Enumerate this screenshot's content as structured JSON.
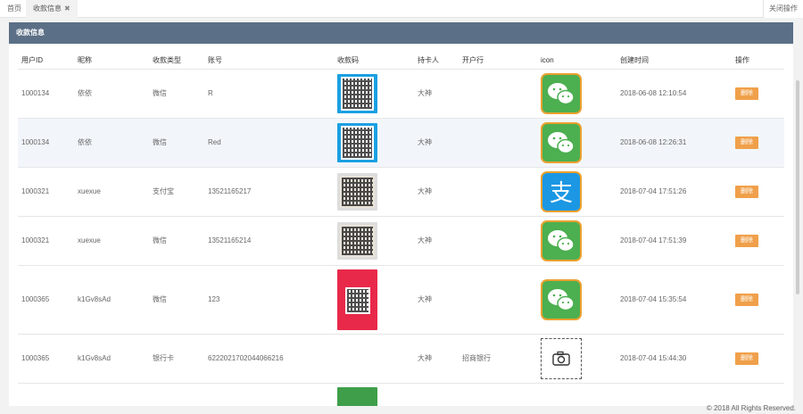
{
  "tabs": {
    "home": "首页",
    "active": "收款信息",
    "close_ops": "关闭操作"
  },
  "panel": {
    "title": "收款信息"
  },
  "columns": [
    "用户ID",
    "昵称",
    "收款类型",
    "账号",
    "收款码",
    "持卡人",
    "开户行",
    "icon",
    "创建时间",
    "操作"
  ],
  "rows": [
    {
      "uid": "1000134",
      "nick": "依依",
      "type": "微信",
      "account": "R",
      "qr": "blue",
      "holder": "大神",
      "bank": "",
      "icon": "wechat-icon",
      "time": "2018-06-08 12:10:54",
      "action": "删除"
    },
    {
      "uid": "1000134",
      "nick": "依依",
      "type": "微信",
      "account": "Red",
      "qr": "blue",
      "holder": "大神",
      "bank": "",
      "icon": "wechat-icon",
      "time": "2018-06-08 12:26:31",
      "action": "删除"
    },
    {
      "uid": "1000321",
      "nick": "xuexue",
      "type": "支付宝",
      "account": "13521165217",
      "qr": "gray",
      "holder": "大神",
      "bank": "",
      "icon": "alipay-icon",
      "time": "2018-07-04 17:51:26",
      "action": "删除"
    },
    {
      "uid": "1000321",
      "nick": "xuexue",
      "type": "微信",
      "account": "13521165214",
      "qr": "gray",
      "holder": "大神",
      "bank": "",
      "icon": "wechat-icon",
      "time": "2018-07-04 17:51:39",
      "action": "删除"
    },
    {
      "uid": "1000365",
      "nick": "k1Gv8sAd",
      "type": "微信",
      "account": "123",
      "qr": "red",
      "holder": "大神",
      "bank": "",
      "icon": "wechat-icon",
      "time": "2018-07-04 15:35:54",
      "action": "删除"
    },
    {
      "uid": "1000365",
      "nick": "k1Gv8sAd",
      "type": "银行卡",
      "account": "6222021702044066216",
      "qr": "none",
      "holder": "大神",
      "bank": "招商银行",
      "icon": "camera-icon",
      "time": "2018-07-04 15:44:30",
      "action": "删除"
    }
  ],
  "footer": "© 2018 All Rights Reserved."
}
